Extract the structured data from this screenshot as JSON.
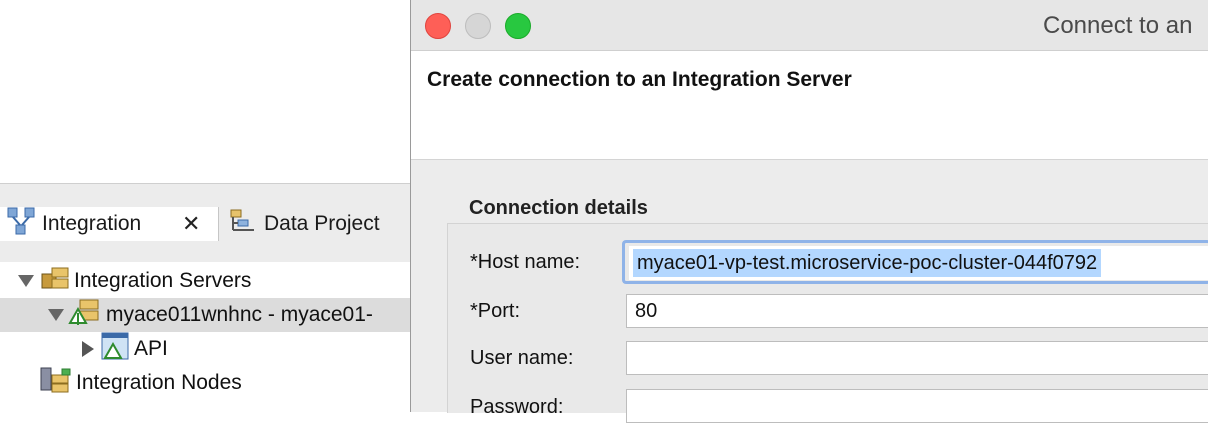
{
  "ide": {
    "tabs": [
      {
        "label": "Integration",
        "icon": "integration-view-icon"
      },
      {
        "label": "Data Project",
        "icon": "data-project-icon"
      }
    ],
    "tree": {
      "servers": "Integration Servers",
      "server_item": "myace011wnhnc - myace01-",
      "api": "API",
      "nodes": "Integration Nodes"
    }
  },
  "dialog": {
    "window_title": "Connect to an",
    "banner_title": "Create connection to an Integration Server",
    "section_title": "Connection details",
    "fields": {
      "host_label": "*Host name:",
      "host_value": "myace01-vp-test.microservice-poc-cluster-044f0792",
      "port_label": "*Port:",
      "port_value": "80",
      "user_label": "User name:",
      "user_value": "",
      "password_label": "Password:"
    }
  },
  "colors": {
    "close": "#fe5f57",
    "maximize": "#28c840",
    "selection": "#b3d7ff",
    "focus_ring": "#8fb3e8"
  }
}
